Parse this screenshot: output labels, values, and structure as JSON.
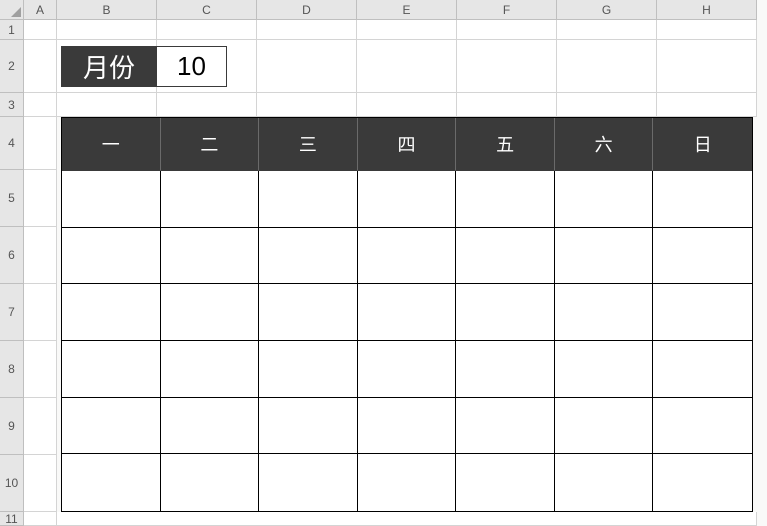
{
  "columns": [
    "A",
    "B",
    "C",
    "D",
    "E",
    "F",
    "G",
    "H"
  ],
  "rows": [
    "1",
    "2",
    "3",
    "4",
    "5",
    "6",
    "7",
    "8",
    "9",
    "10",
    "11"
  ],
  "month": {
    "label": "月份",
    "value": "10"
  },
  "weekdays": [
    "一",
    "二",
    "三",
    "四",
    "五",
    "六",
    "日"
  ],
  "calendar_rows": 6,
  "calendar_cols": 7
}
